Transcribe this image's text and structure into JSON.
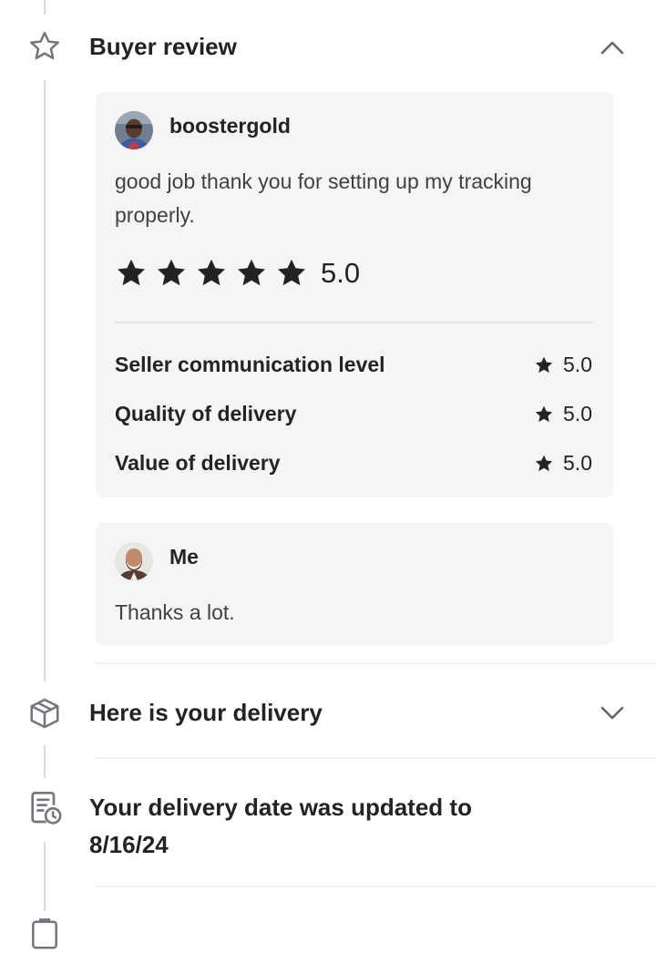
{
  "buyer_review": {
    "title": "Buyer review",
    "review": {
      "username": "boostergold",
      "text": "good job thank you for setting up my tracking properly.",
      "rating": 5,
      "overall_score": "5.0",
      "criteria": [
        {
          "label": "Seller communication level",
          "score": "5.0"
        },
        {
          "label": "Quality of delivery",
          "score": "5.0"
        },
        {
          "label": "Value of delivery",
          "score": "5.0"
        }
      ]
    },
    "reply": {
      "username": "Me",
      "text": "Thanks a lot."
    }
  },
  "delivery": {
    "title": "Here is your delivery"
  },
  "delivery_date_update": {
    "title": "Your delivery date was updated to 8/16/24"
  },
  "colors": {
    "star": "#222325",
    "card_background": "#f5f5f5",
    "timeline": "#dadbdd",
    "icon_stroke": "#74767e"
  },
  "icons": {
    "buyer_review": "star-outline-icon",
    "delivery": "package-icon",
    "delivery_date": "document-clock-icon",
    "expanded": "chevron-up-icon",
    "collapsed": "chevron-down-icon"
  }
}
